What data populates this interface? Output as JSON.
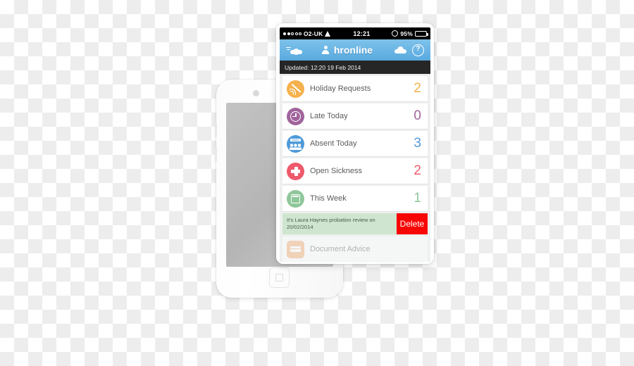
{
  "background_phone": {
    "description": "white-iphone",
    "home_button": "home-button"
  },
  "device": {
    "status_bar": {
      "carrier": "O2-UK",
      "signal_dots_filled": 2,
      "signal_dots_total": 5,
      "wifi_icon": "wifi-icon",
      "time": "12:21",
      "alarm_icon": "alarm-icon",
      "battery_percent": "95%",
      "battery_level": 95,
      "battery_color": "#4cd24c",
      "charging_icon": "plug-icon"
    },
    "app_header": {
      "sync_icon": "cloud-sync-icon",
      "person_icon": "person-icon",
      "title": "hronline",
      "cloud_icon": "cloud-icon",
      "help_icon": "help-circle-icon",
      "background_color": "#59a9df"
    },
    "updated_bar": {
      "text": "Updated: 12:20 19 Feb 2014",
      "background_color": "#262626"
    },
    "list": {
      "rows": [
        {
          "icon": "beach-ball-icon",
          "label": "Holiday Requests",
          "count": "2",
          "color": "#f5b14c"
        },
        {
          "icon": "clock-icon",
          "label": "Late Today",
          "count": "0",
          "color": "#a1649c"
        },
        {
          "icon": "people-today-icon",
          "label": "Absent Today",
          "count": "3",
          "color": "#4f9ad8"
        },
        {
          "icon": "medical-cross-icon",
          "label": "Open Sickness",
          "count": "2",
          "color": "#ee5a6b"
        },
        {
          "icon": "calendar-icon",
          "label": "This Week",
          "count": "1",
          "color": "#8fc79a"
        }
      ],
      "notification": {
        "text": "It's Laura Haynes probation review on 20/02/2014",
        "delete_label": "Delete",
        "background_color": "#cfe5cf",
        "delete_color": "#f80505"
      },
      "partial_row": {
        "icon": "document-icon",
        "label": "Document Advice",
        "color": "#f3a96f"
      }
    }
  }
}
